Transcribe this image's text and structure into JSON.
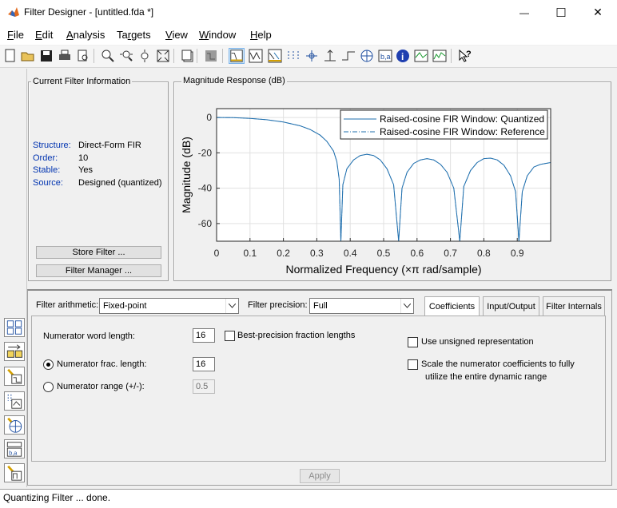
{
  "window": {
    "title": "Filter Designer -  [untitled.fda *]",
    "minimize_glyph": "—",
    "maximize_glyph": "☐",
    "close_glyph": "✕"
  },
  "menu": [
    {
      "label": "File",
      "u": "F",
      "rest": "ile"
    },
    {
      "label": "Edit",
      "u": "E",
      "rest": "dit"
    },
    {
      "label": "Analysis",
      "u": "A",
      "rest": "nalysis"
    },
    {
      "label": "Targets",
      "pre": "Ta",
      "u": "r",
      "rest": "gets"
    },
    {
      "label": "View",
      "u": "V",
      "rest": "iew"
    },
    {
      "label": "Window",
      "u": "W",
      "rest": "indow"
    },
    {
      "label": "Help",
      "u": "H",
      "rest": "elp"
    }
  ],
  "toolbar_icons": [
    "new-icon",
    "open-icon",
    "save-icon",
    "print-icon",
    "print-preview-icon",
    "zoom-in-icon",
    "zoom-x-icon",
    "zoom-y-icon",
    "full-view-icon",
    "new-window-icon",
    "filter-spec-icon",
    "magnitude-response-icon",
    "phase-response-icon",
    "mag-phase-icon",
    "group-delay-icon",
    "phase-delay-icon",
    "impulse-response-icon",
    "step-response-icon",
    "pole-zero-icon",
    "coefficients-icon",
    "info-icon",
    "magnitude-estimate-icon",
    "noise-power-icon",
    "whats-this-icon"
  ],
  "info_panel": {
    "title": "Current Filter Information",
    "rows": [
      {
        "key": "Structure:",
        "value": "Direct-Form FIR"
      },
      {
        "key": "Order:",
        "value": "10"
      },
      {
        "key": "Stable:",
        "value": "Yes"
      },
      {
        "key": "Source:",
        "value": "Designed (quantized)"
      }
    ],
    "store_button": "Store Filter ...",
    "manager_button": "Filter Manager ..."
  },
  "plot_panel": {
    "title": "Magnitude Response (dB)"
  },
  "chart_data": {
    "type": "line",
    "xlabel": "Normalized Frequency (×π rad/sample)",
    "ylabel": "Magnitude (dB)",
    "xlim": [
      0,
      1
    ],
    "ylim": [
      -70,
      5
    ],
    "xticks": [
      "0",
      "0.1",
      "0.2",
      "0.3",
      "0.4",
      "0.5",
      "0.6",
      "0.7",
      "0.8",
      "0.9"
    ],
    "yticks": [
      "0",
      "-20",
      "-40",
      "-60"
    ],
    "grid": true,
    "legend_position": "top-right",
    "series": [
      {
        "name": "Raised-cosine FIR Window: Quantized",
        "style": "solid",
        "color": "#1f6fae"
      },
      {
        "name": "Raised-cosine FIR Window: Reference",
        "style": "dashdot",
        "color": "#1f6fae"
      }
    ],
    "points": [
      [
        0,
        0
      ],
      [
        0.05,
        -0.1
      ],
      [
        0.1,
        -0.5
      ],
      [
        0.15,
        -1.3
      ],
      [
        0.2,
        -2.6
      ],
      [
        0.25,
        -4.7
      ],
      [
        0.28,
        -6.8
      ],
      [
        0.31,
        -10
      ],
      [
        0.33,
        -13.5
      ],
      [
        0.35,
        -19
      ],
      [
        0.36,
        -25
      ],
      [
        0.367,
        -35
      ],
      [
        0.372,
        -70
      ],
      [
        0.378,
        -38
      ],
      [
        0.39,
        -29
      ],
      [
        0.41,
        -24
      ],
      [
        0.43,
        -21.5
      ],
      [
        0.45,
        -20.8
      ],
      [
        0.47,
        -21.5
      ],
      [
        0.49,
        -24
      ],
      [
        0.51,
        -29
      ],
      [
        0.53,
        -38
      ],
      [
        0.545,
        -70
      ],
      [
        0.555,
        -40
      ],
      [
        0.57,
        -31
      ],
      [
        0.59,
        -26
      ],
      [
        0.61,
        -24
      ],
      [
        0.63,
        -23.3
      ],
      [
        0.65,
        -24
      ],
      [
        0.67,
        -26.5
      ],
      [
        0.69,
        -31
      ],
      [
        0.71,
        -40
      ],
      [
        0.728,
        -70
      ],
      [
        0.74,
        -39
      ],
      [
        0.76,
        -30
      ],
      [
        0.78,
        -25.5
      ],
      [
        0.8,
        -23.3
      ],
      [
        0.82,
        -23
      ],
      [
        0.84,
        -24
      ],
      [
        0.86,
        -27
      ],
      [
        0.88,
        -33
      ],
      [
        0.895,
        -42
      ],
      [
        0.905,
        -70
      ],
      [
        0.915,
        -42
      ],
      [
        0.93,
        -33
      ],
      [
        0.95,
        -28
      ],
      [
        0.97,
        -26.5
      ],
      [
        0.99,
        -25.8
      ],
      [
        1.0,
        -25.5
      ]
    ]
  },
  "quant_panel": {
    "arith_label": "Filter arithmetic:",
    "arith_value": "Fixed-point",
    "precision_label": "Filter precision:",
    "precision_value": "Full",
    "tabs": [
      "Coefficients",
      "Input/Output",
      "Filter Internals"
    ],
    "num_word_length_label": "Numerator word length:",
    "num_word_length_value": "16",
    "best_precision_label": "Best-precision fraction lengths",
    "num_frac_label": "Numerator frac. length:",
    "num_frac_value": "16",
    "num_range_label": "Numerator range (+/-):",
    "num_range_value": "0.5",
    "unsigned_label": "Use unsigned representation",
    "scale_label_line1": "Scale the numerator coefficients to fully",
    "scale_label_line2": "utilize the entire dynamic range",
    "apply_button": "Apply"
  },
  "left_tools": [
    "transform-filter-icon",
    "realize-model-icon",
    "design-filter-icon",
    "import-filter-icon",
    "pole-zero-editor-icon",
    "multirate-icon",
    "quantize-filter-icon"
  ],
  "status": {
    "text": "Quantizing Filter ... done."
  }
}
